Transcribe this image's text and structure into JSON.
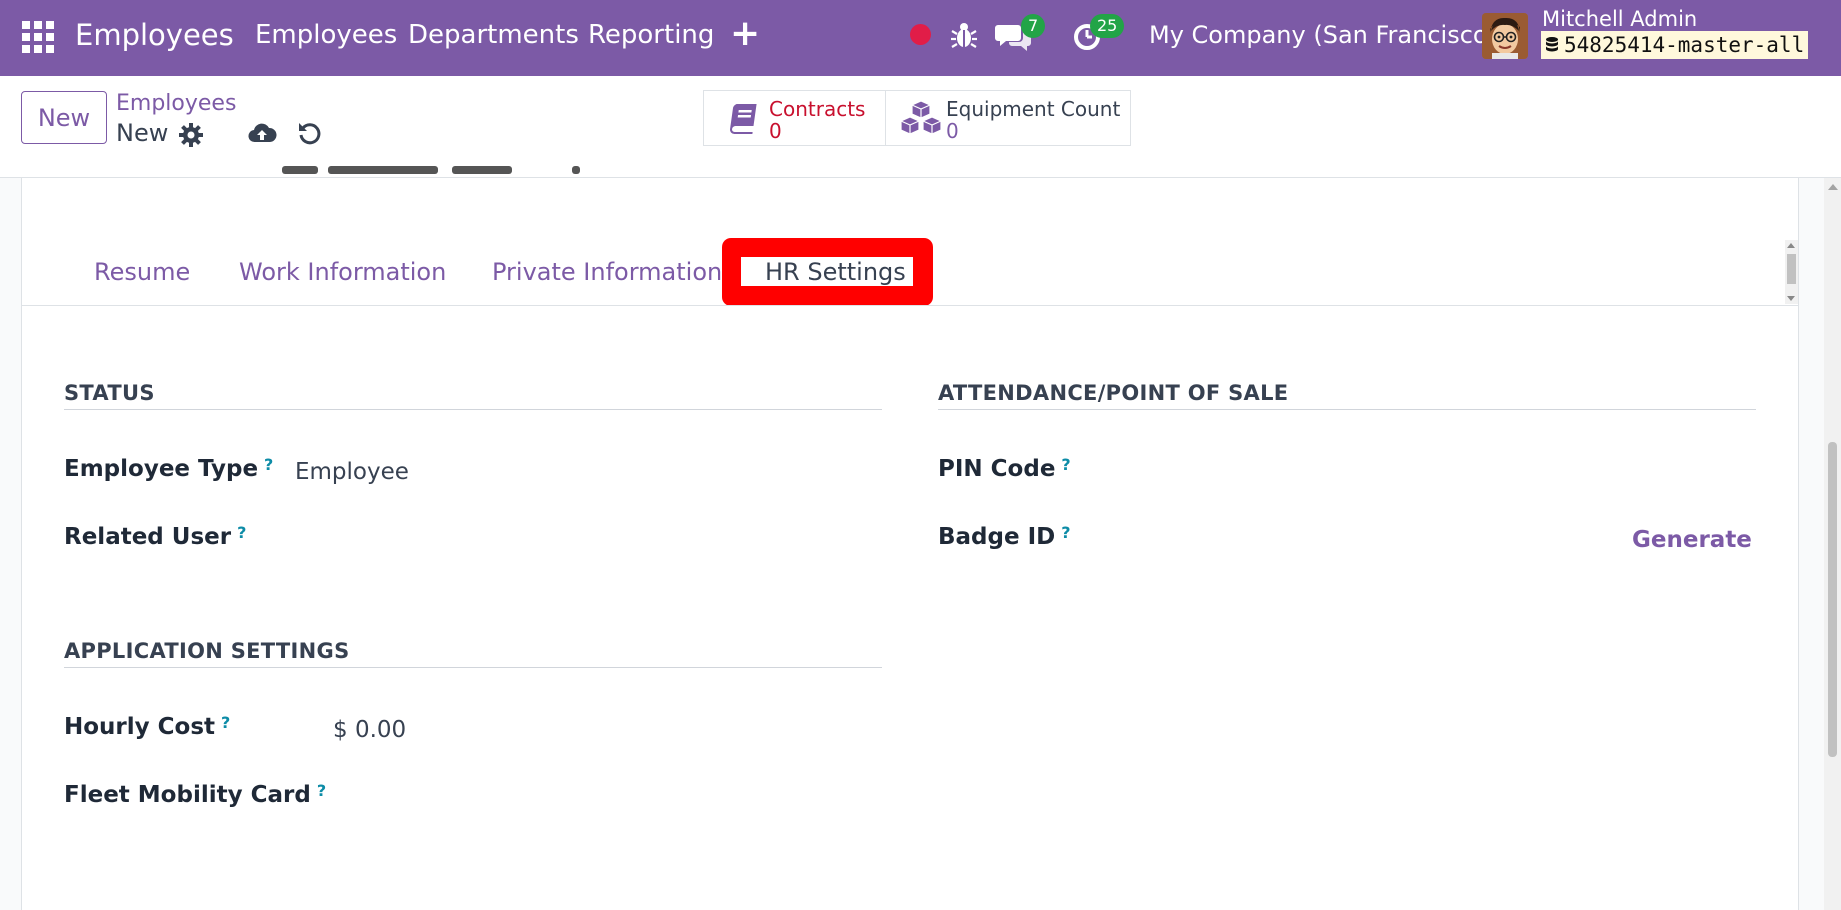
{
  "navbar": {
    "app_title": "Employees",
    "menu": [
      "Employees",
      "Departments",
      "Reporting"
    ],
    "add_symbol": "+",
    "messages_count": "7",
    "activities_count": "25",
    "company": "My Company (San Francisco)",
    "user_name": "Mitchell Admin",
    "database": "54825414-master-all",
    "colors": {
      "bar": "#7c5aa6",
      "badge": "#22a447",
      "record": "#e11d48"
    }
  },
  "control_panel": {
    "new_button": "New",
    "breadcrumb_parent": "Employees",
    "breadcrumb_current": "New",
    "smart_buttons": [
      {
        "label": "Contracts",
        "value": "0",
        "icon": "book-icon"
      },
      {
        "label": "Equipment Count",
        "value": "0",
        "icon": "cubes-icon"
      }
    ]
  },
  "tabs": [
    "Resume",
    "Work Information",
    "Private Information",
    "HR Settings"
  ],
  "active_tab": "HR Settings",
  "form": {
    "status": {
      "title": "STATUS",
      "employee_type_label": "Employee Type",
      "employee_type_value": "Employee",
      "related_user_label": "Related User"
    },
    "attendance": {
      "title": "ATTENDANCE/POINT OF SALE",
      "pin_label": "PIN Code",
      "badge_label": "Badge ID",
      "generate_label": "Generate"
    },
    "application": {
      "title": "APPLICATION SETTINGS",
      "hourly_cost_label": "Hourly Cost",
      "hourly_cost_value": "$ 0.00",
      "fleet_card_label": "Fleet Mobility Card"
    },
    "help_mark": "?"
  }
}
